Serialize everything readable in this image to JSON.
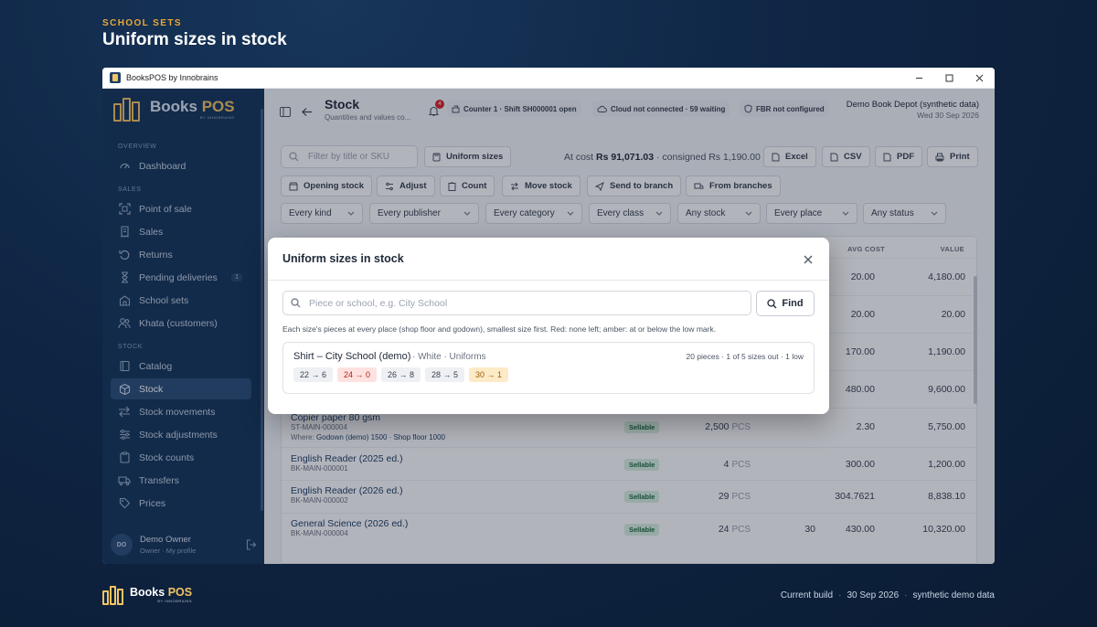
{
  "page": {
    "eyebrow": "SCHOOL SETS",
    "heading": "Uniform sizes in stock"
  },
  "window": {
    "title": "BooksPOS by Innobrains",
    "controls": [
      "minimize-icon",
      "maximize-icon",
      "close-icon"
    ]
  },
  "brand": {
    "name_a": "Books",
    "name_b": "POS",
    "tagline": "BY INNOBRAINS"
  },
  "sidebar": {
    "sections": {
      "overview": "OVERVIEW",
      "sales": "SALES",
      "stock": "STOCK"
    },
    "items": [
      {
        "label": "Dashboard",
        "icon": "gauge-icon"
      },
      {
        "label": "Point of sale",
        "icon": "scan-icon"
      },
      {
        "label": "Sales",
        "icon": "receipt-icon"
      },
      {
        "label": "Returns",
        "icon": "return-icon"
      },
      {
        "label": "Pending deliveries",
        "icon": "hourglass-icon",
        "count": "1"
      },
      {
        "label": "School sets",
        "icon": "school-icon"
      },
      {
        "label": "Khata (customers)",
        "icon": "users-icon"
      },
      {
        "label": "Catalog",
        "icon": "book-icon"
      },
      {
        "label": "Stock",
        "icon": "box-icon",
        "active": true
      },
      {
        "label": "Stock movements",
        "icon": "arrows-icon"
      },
      {
        "label": "Stock adjustments",
        "icon": "sliders-icon"
      },
      {
        "label": "Stock counts",
        "icon": "clipboard-icon"
      },
      {
        "label": "Transfers",
        "icon": "truck-icon"
      },
      {
        "label": "Prices",
        "icon": "tag-icon"
      }
    ],
    "user": {
      "initials": "DO",
      "name": "Demo Owner",
      "role": "Owner",
      "sep": "·",
      "profile": "My profile"
    }
  },
  "header": {
    "title": "Stock",
    "subtitle": "Quantities and values co...",
    "bell_count": "4",
    "counter": "Counter 1 · Shift SH000001 open",
    "cloud": "Cloud not connected · 59 waiting",
    "fbr": "FBR not configured",
    "store_name": "Demo Book Depot (synthetic data)",
    "store_date": "Wed 30 Sep 2026"
  },
  "toolbar": {
    "filter_placeholder": "Filter by title or SKU",
    "uniform_sizes": "Uniform sizes",
    "totals_prefix": "At cost",
    "totals_value": "Rs 91,071.03",
    "totals_suffix": "· consigned Rs 1,190.00",
    "exports": [
      "Excel",
      "CSV",
      "PDF",
      "Print"
    ],
    "actions": [
      "Opening stock",
      "Adjust",
      "Count",
      "Move stock",
      "Send to branch",
      "From branches"
    ],
    "filters": [
      "Every kind",
      "Every publisher",
      "Every category",
      "Every class",
      "Any stock",
      "Every place",
      "Any status"
    ]
  },
  "table": {
    "headers": {
      "avg_cost": "AVG COST",
      "value": "VALUE"
    },
    "hidden_rows": [
      {
        "avg": "20.00",
        "value": "4,180.00"
      },
      {
        "avg": "20.00",
        "value": "20.00"
      },
      {
        "avg": "170.00",
        "value": "1,190.00"
      },
      {
        "avg": "480.00",
        "value": "9,600.00"
      }
    ],
    "rows": [
      {
        "name": "Copier paper 80 gsm",
        "sku": "ST-MAIN-000004",
        "where_label": "Where:",
        "where": "Godown (demo) 1500 · Shop floor 1000",
        "status": "Sellable",
        "qty": "2,500",
        "unit": "PCS",
        "reorder": "",
        "avg": "2.30",
        "value": "5,750.00"
      },
      {
        "name": "English Reader (2025 ed.)",
        "sku": "BK-MAIN-000001",
        "status": "Sellable",
        "qty": "4",
        "unit": "PCS",
        "reorder": "",
        "avg": "300.00",
        "value": "1,200.00"
      },
      {
        "name": "English Reader (2026 ed.)",
        "sku": "BK-MAIN-000002",
        "status": "Sellable",
        "qty": "29",
        "unit": "PCS",
        "reorder": "",
        "avg": "304.7621",
        "value": "8,838.10"
      },
      {
        "name": "General Science (2026 ed.)",
        "sku": "BK-MAIN-000004",
        "status": "Sellable",
        "qty": "24",
        "unit": "PCS",
        "reorder": "30",
        "avg": "430.00",
        "value": "10,320.00"
      }
    ]
  },
  "modal": {
    "title": "Uniform sizes in stock",
    "search_placeholder": "Piece or school, e.g. City School",
    "find_label": "Find",
    "help": "Each size's pieces at every place (shop floor and godown), smallest size first. Red: none left; amber: at or below the low mark.",
    "set": {
      "name": "Shirt – City School (demo)",
      "meta": "· White · Uniforms",
      "summary": "20 pieces · 1 of 5 sizes out · 1 low",
      "sizes": [
        {
          "label": "22 → 6",
          "size": 22,
          "pieces": 6,
          "state": "ok"
        },
        {
          "label": "24 → 0",
          "size": 24,
          "pieces": 0,
          "state": "out"
        },
        {
          "label": "26 → 8",
          "size": 26,
          "pieces": 8,
          "state": "ok"
        },
        {
          "label": "28 → 5",
          "size": 28,
          "pieces": 5,
          "state": "ok"
        },
        {
          "label": "30 → 1",
          "size": 30,
          "pieces": 1,
          "state": "low"
        }
      ]
    },
    "colors": {
      "out": "#fde2df",
      "low": "#fdebc8"
    }
  },
  "footer": {
    "brand_a": "Books",
    "brand_b": "POS",
    "build_label": "Current build",
    "date": "30 Sep 2026",
    "note": "synthetic demo data",
    "sep": "·"
  }
}
